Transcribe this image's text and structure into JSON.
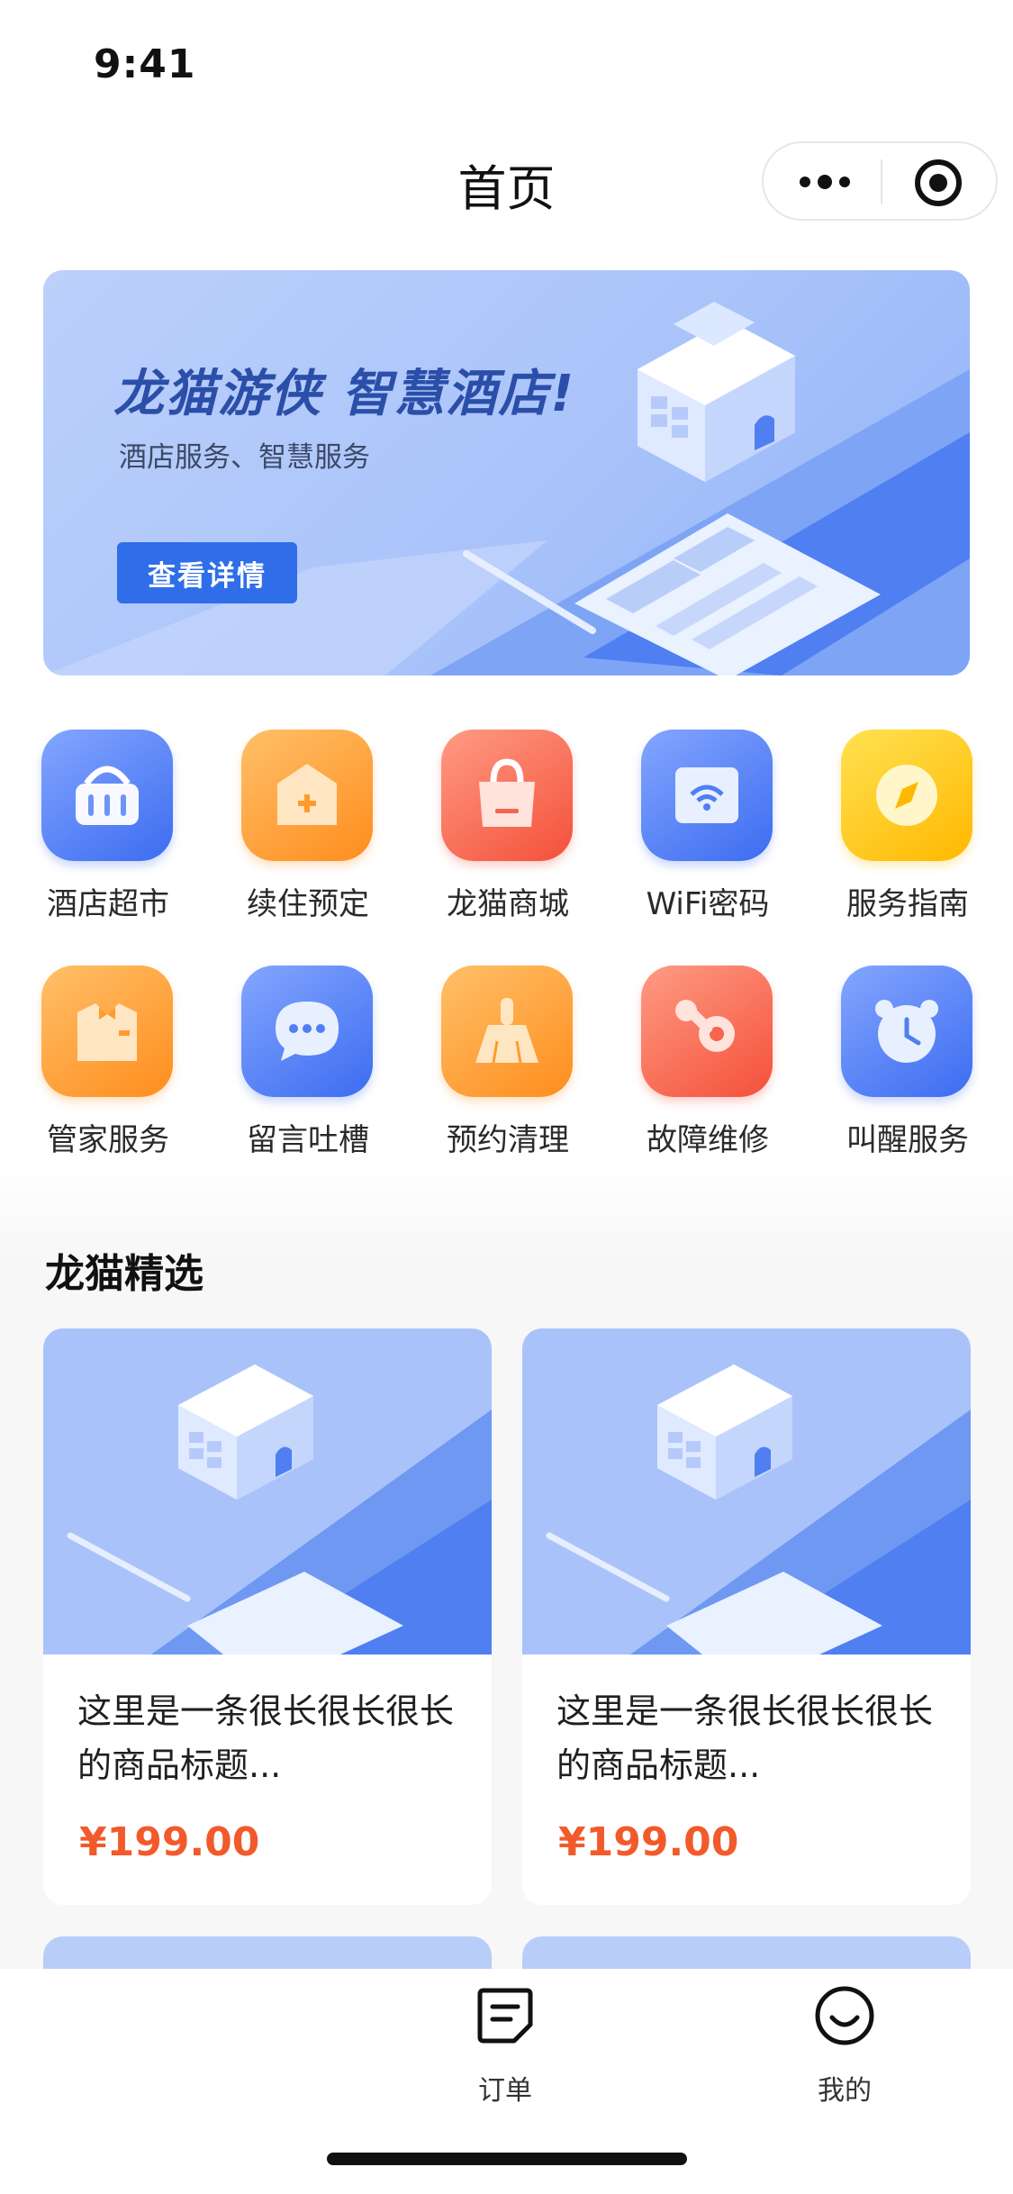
{
  "status_bar": {
    "time": "9:41"
  },
  "nav": {
    "title": "首页",
    "more_icon": "more-dots-icon",
    "target_icon": "target-icon"
  },
  "banner": {
    "title": "龙猫游侠 智慧酒店!",
    "subtitle": "酒店服务、智慧服务",
    "button_label": "查看详情"
  },
  "grid": [
    {
      "label": "酒店超市",
      "icon": "basket-icon",
      "color": "blue"
    },
    {
      "label": "续住预定",
      "icon": "house-icon",
      "color": "orange"
    },
    {
      "label": "龙猫商城",
      "icon": "shopping-bag-icon",
      "color": "red"
    },
    {
      "label": "WiFi密码",
      "icon": "wifi-icon",
      "color": "blue"
    },
    {
      "label": "服务指南",
      "icon": "compass-icon",
      "color": "yellow"
    },
    {
      "label": "管家服务",
      "icon": "butler-shirt-icon",
      "color": "orange"
    },
    {
      "label": "留言吐槽",
      "icon": "chat-bubble-icon",
      "color": "blue"
    },
    {
      "label": "预约清理",
      "icon": "broom-icon",
      "color": "orange"
    },
    {
      "label": "故障维修",
      "icon": "wrench-gear-icon",
      "color": "red"
    },
    {
      "label": "叫醒服务",
      "icon": "alarm-clock-icon",
      "color": "blue"
    }
  ],
  "section": {
    "title": "龙猫精选"
  },
  "products": [
    {
      "title": "这里是一条很长很长很长的商品标题...",
      "price": "¥199.00"
    },
    {
      "title": "这里是一条很长很长很长的商品标题...",
      "price": "¥199.00"
    }
  ],
  "tabbar": [
    {
      "label": "订单",
      "icon": "order-icon"
    },
    {
      "label": "我的",
      "icon": "smile-profile-icon"
    }
  ],
  "colors": {
    "accent": "#2f6ee8",
    "price": "#f25a2c",
    "banner_bg": "#a9c3fa"
  }
}
